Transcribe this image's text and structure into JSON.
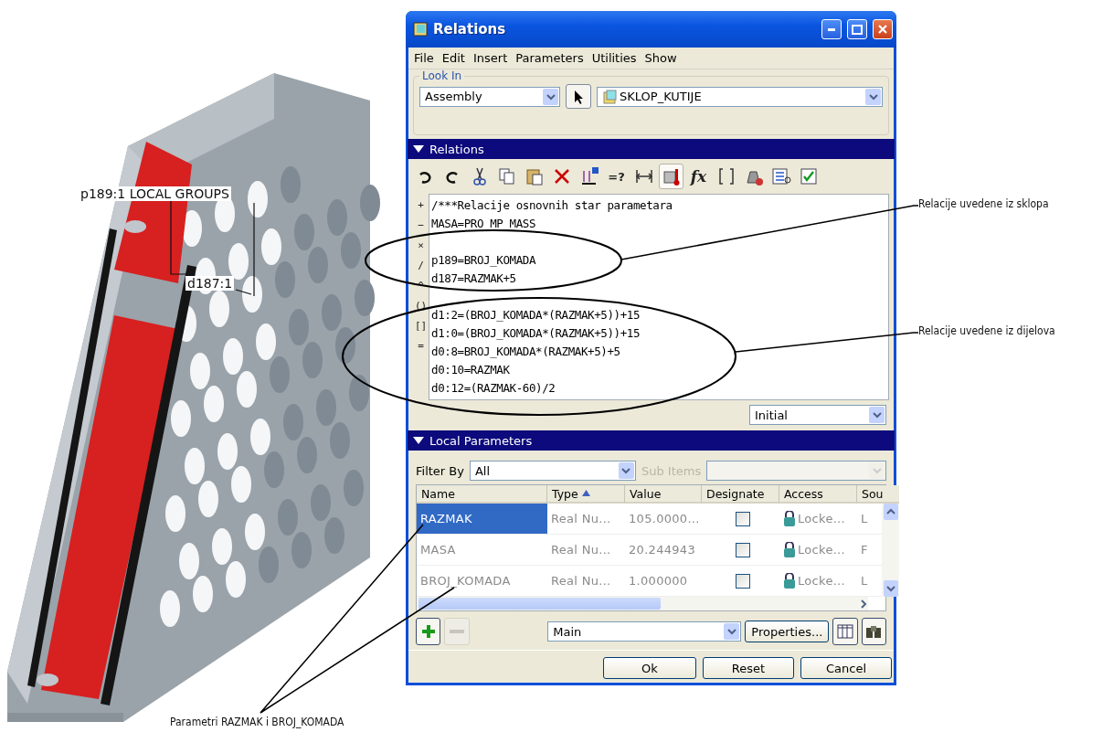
{
  "model_view": {
    "labels": [
      {
        "text": "p189:1 LOCAL GROUPS"
      },
      {
        "text": "d187:1"
      }
    ]
  },
  "window": {
    "title": "Relations"
  },
  "menu": [
    "File",
    "Edit",
    "Insert",
    "Parameters",
    "Utilities",
    "Show"
  ],
  "look_in": {
    "label": "Look In",
    "type": "Assembly",
    "model": "SKLOP_KUTIJE"
  },
  "relations": {
    "header": "Relations",
    "expanded": true,
    "toolbar": [
      {
        "kind": "undo"
      },
      {
        "kind": "redo"
      },
      {
        "kind": "cut"
      },
      {
        "kind": "copy"
      },
      {
        "kind": "paste"
      },
      {
        "kind": "delete"
      },
      {
        "kind": "dimension"
      },
      {
        "kind": "glyph",
        "text": "=?"
      },
      {
        "kind": "span"
      },
      {
        "kind": "units",
        "selected": true
      },
      {
        "kind": "glyph",
        "text": "fx"
      },
      {
        "kind": "brackets"
      },
      {
        "kind": "weight"
      },
      {
        "kind": "list"
      },
      {
        "kind": "verify"
      }
    ],
    "operators": [
      "+",
      "−",
      "×",
      "/",
      "^",
      "()",
      "[]",
      "="
    ],
    "blocks": [
      [
        "/***Relacije osnovnih star parametara",
        "MASA=PRO_MP_MASS"
      ],
      [
        "p189=BROJ_KOMADA",
        "d187=RAZMAK+5"
      ],
      [
        "d1:2=(BROJ_KOMADA*(RAZMAK+5))+15",
        "d1:0=(BROJ_KOMADA*(RAZMAK+5))+15",
        "d0:8=BROJ_KOMADA*(RAZMAK+5)+5",
        "d0:10=RAZMAK",
        "d0:12=(RAZMAK-60)/2"
      ]
    ],
    "mode": "Initial"
  },
  "local_parameters": {
    "header": "Local Parameters",
    "expanded": true,
    "filter_label": "Filter By",
    "filter": "All",
    "sub_items_label": "Sub Items",
    "columns": [
      "Name",
      "Type",
      "Value",
      "Designate",
      "Access",
      "Sou"
    ],
    "rows": [
      {
        "name": "RAZMAK",
        "type": "Real Nu...",
        "value": "105.0000...",
        "designate": false,
        "access": "Locke...",
        "source": "L",
        "selected": true
      },
      {
        "name": "MASA",
        "type": "Real Nu...",
        "value": "20.244943",
        "designate": false,
        "access": "Locke...",
        "source": "F",
        "selected": false
      },
      {
        "name": "BROJ_KOMADA",
        "type": "Real Nu...",
        "value": "1.000000",
        "designate": false,
        "access": "Locke...",
        "source": "L",
        "selected": false
      }
    ],
    "set": "Main",
    "properties_button": "Properties..."
  },
  "buttons": [
    "Ok",
    "Reset",
    "Cancel"
  ],
  "annotations": [
    {
      "text": "Relacije uvedene iz sklopa"
    },
    {
      "text": "Relacije uvedene iz dijelova"
    },
    {
      "text": "Parametri RAZMAK i BROJ_KOMADA"
    }
  ]
}
